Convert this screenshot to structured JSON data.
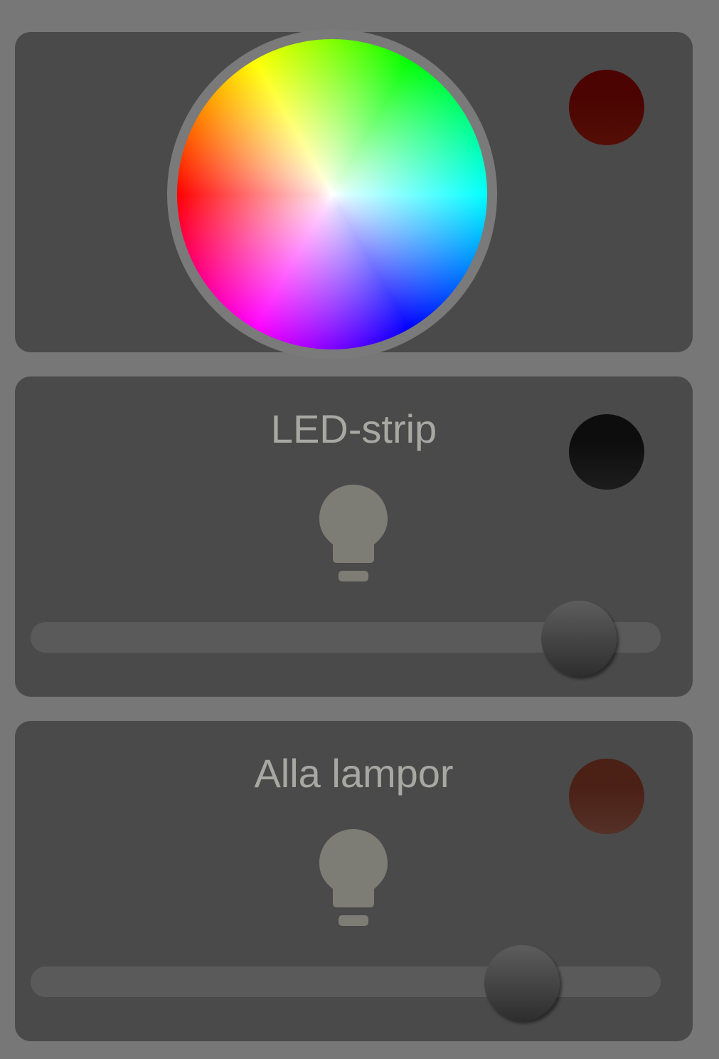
{
  "cards": [
    {
      "title": "",
      "swatch_color": "#8a2010",
      "color_wheel": {
        "open": true
      }
    },
    {
      "title": "LED-strip",
      "swatch_color": "#3a3a3a",
      "icon": "lightbulb-icon",
      "brightness": 0.87
    },
    {
      "title": "Alla lampor",
      "swatch_color": "#8a5a4a",
      "icon": "lightbulb-icon",
      "brightness": 0.78
    }
  ]
}
